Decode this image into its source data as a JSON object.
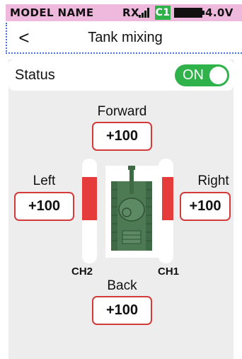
{
  "status_bar": {
    "model_name": "MODEL NAME",
    "rx_label": "RX",
    "signal_icon": "signal-bars-icon",
    "channel_badge": "C1",
    "battery_icon": "battery-icon",
    "voltage": "4.0V",
    "background_color": "#eeb9dc",
    "badge_color": "#2fb24a"
  },
  "header": {
    "back_icon": "chevron-left-icon",
    "back_glyph": "<",
    "title": "Tank mixing"
  },
  "status": {
    "label": "Status",
    "toggle_label": "ON",
    "toggle_on": true,
    "toggle_color": "#2fb24a"
  },
  "controls": {
    "forward": {
      "label": "Forward",
      "value": "+100"
    },
    "left": {
      "label": "Left",
      "value": "+100"
    },
    "right": {
      "label": "Right",
      "value": "+100"
    },
    "back": {
      "label": "Back",
      "value": "+100"
    }
  },
  "channels": {
    "ch2": {
      "label": "CH2",
      "level_fraction": 0.5,
      "fill_from": "middle-up"
    },
    "ch1": {
      "label": "CH1",
      "level_fraction": 0.5,
      "fill_from": "middle-up"
    },
    "fill_color": "#e63b3b"
  },
  "tank_icon": "tank-icon",
  "accent_color": "#d33b3b"
}
